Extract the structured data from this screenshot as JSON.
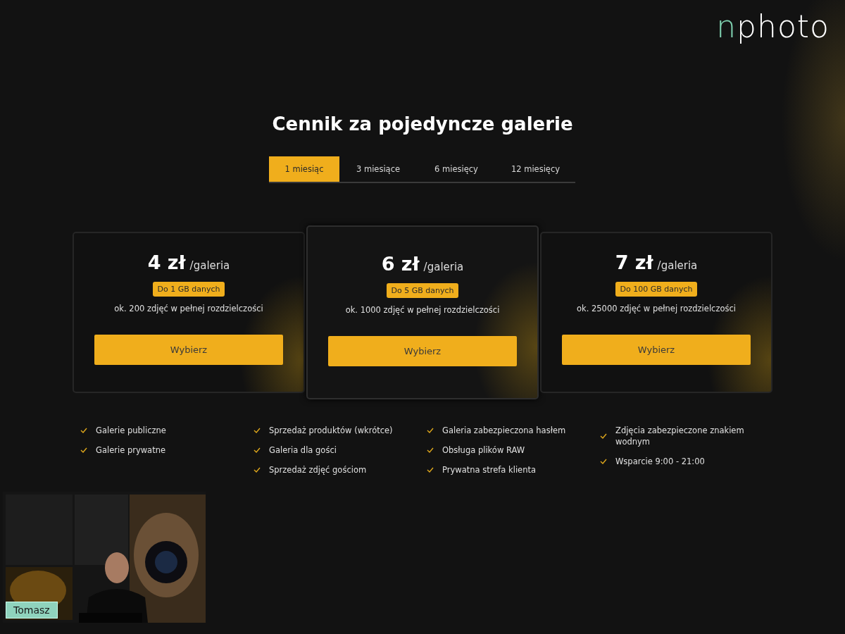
{
  "logo": {
    "accent": "n",
    "text": "photo"
  },
  "title": "Cennik za pojedyncze galerie",
  "tabs": [
    {
      "label": "1 miesiąc",
      "selected": true
    },
    {
      "label": "3 miesiące",
      "selected": false
    },
    {
      "label": "6 miesięcy",
      "selected": false
    },
    {
      "label": "12 miesięcy",
      "selected": false
    }
  ],
  "plans": [
    {
      "price": "4 zł",
      "unit": "/galeria",
      "badge": "Do 1 GB danych",
      "note": "ok. 200 zdjęć w pełnej rozdzielczości",
      "button": "Wybierz",
      "featured": false
    },
    {
      "price": "6 zł",
      "unit": "/galeria",
      "badge": "Do 5 GB danych",
      "note": "ok. 1000 zdjęć w pełnej rozdzielczości",
      "button": "Wybierz",
      "featured": true
    },
    {
      "price": "7 zł",
      "unit": "/galeria",
      "badge": "Do 100 GB danych",
      "note": "ok. 25000 zdjęć w pełnej rozdzielczości",
      "button": "Wybierz",
      "featured": false
    }
  ],
  "feature_columns": [
    {
      "items": [
        "Galerie publiczne",
        "Galerie prywatne"
      ]
    },
    {
      "items": [
        "Sprzedaż produktów (wkrótce)",
        "Galeria dla gości",
        "Sprzedaż zdjęć gościom"
      ]
    },
    {
      "items": [
        "Galeria zabezpieczona hasłem",
        "Obsługa plików RAW",
        "Prywatna strefa klienta"
      ]
    },
    {
      "items": [
        "Zdjęcia zabezpieczone znakiem wodnym",
        "Wsparcie 9:00 - 21:00"
      ]
    }
  ],
  "webcam": {
    "kind": "picture",
    "name_tag": "Tomasz"
  }
}
